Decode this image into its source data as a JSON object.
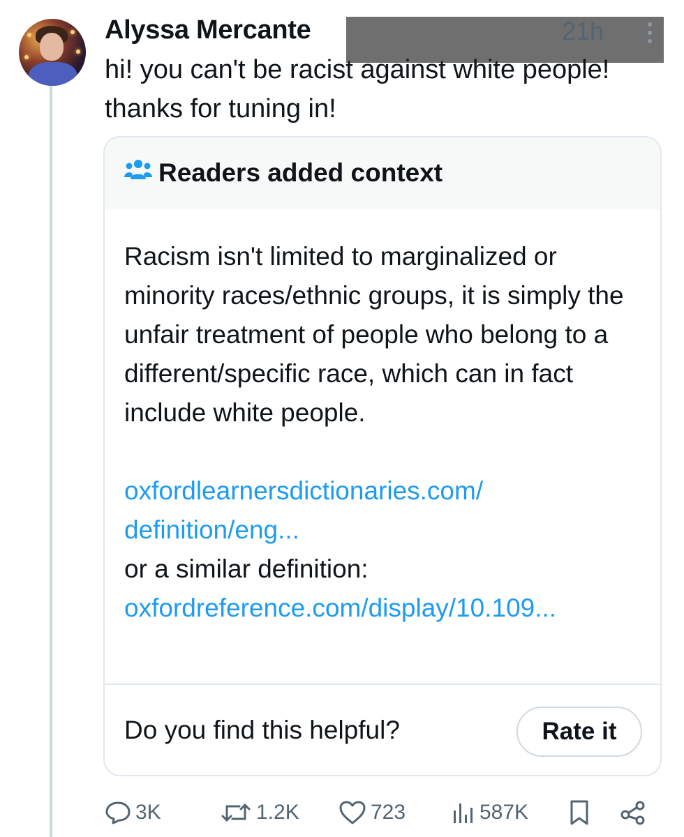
{
  "tweet": {
    "author_name": "Alyssa Mercante",
    "time": "21h",
    "text": "hi! you can't be racist against white people! thanks for tuning in!"
  },
  "community_note": {
    "title": "Readers added context",
    "body": "Racism isn't limited to marginalized or minority races/ethnic groups, it is simply the unfair treatment of people who belong to a different/specific race, which can in fact include white people.",
    "link1_line1": "oxfordlearnersdictionaries.com/",
    "link1_line2": "definition/eng...",
    "similar_text": "or a similar definition:",
    "link2": "oxfordreference.com/display/10.109...",
    "helpful_prompt": "Do you find this helpful?",
    "rate_label": "Rate it"
  },
  "actions": {
    "replies": "3K",
    "reposts": "1.2K",
    "likes": "723",
    "views": "587K"
  },
  "icons": {
    "reply": "reply-icon",
    "repost": "repost-icon",
    "like": "heart-icon",
    "views": "views-icon",
    "bookmark": "bookmark-icon",
    "share": "share-icon",
    "note": "people-icon",
    "more": "more-icon"
  },
  "colors": {
    "link": "#1d9bf0",
    "secondary_text": "#536471",
    "note_header_bg": "#f7f9f9"
  }
}
